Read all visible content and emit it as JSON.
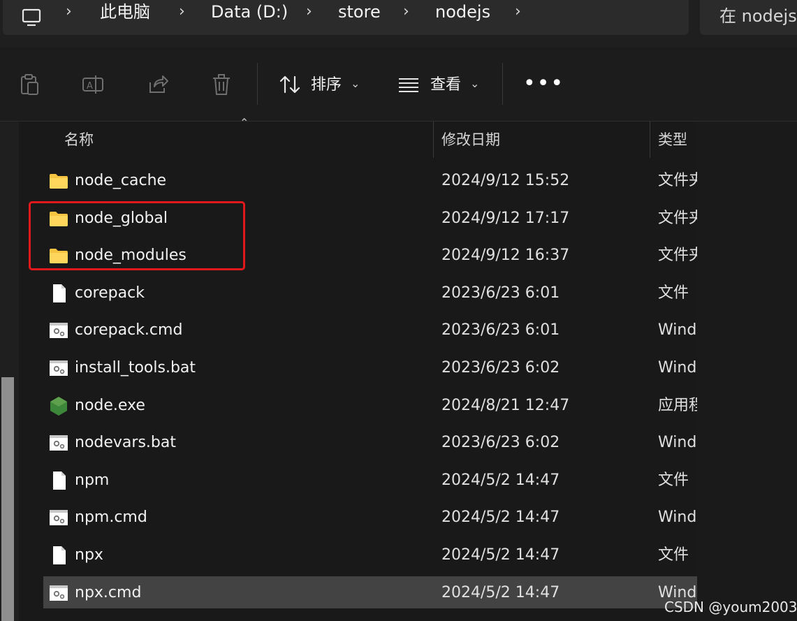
{
  "address_bar": {
    "breadcrumbs": [
      "此电脑",
      "Data (D:)",
      "store",
      "nodejs"
    ],
    "search_placeholder": "在 nodejs"
  },
  "toolbar": {
    "icons": [
      "paste-icon",
      "rename-icon",
      "share-icon",
      "delete-icon"
    ],
    "sort_label": "排序",
    "view_label": "查看",
    "more_label": "•••"
  },
  "columns": {
    "name": "名称",
    "modified": "修改日期",
    "type": "类型"
  },
  "files": [
    {
      "name": "node_cache",
      "modified": "2024/9/12 15:52",
      "type": "文件夹",
      "icon": "folder-icon"
    },
    {
      "name": "node_global",
      "modified": "2024/9/12 17:17",
      "type": "文件夹",
      "icon": "folder-icon"
    },
    {
      "name": "node_modules",
      "modified": "2024/9/12 16:37",
      "type": "文件夹",
      "icon": "folder-icon"
    },
    {
      "name": "corepack",
      "modified": "2023/6/23 6:01",
      "type": "文件",
      "icon": "file-icon"
    },
    {
      "name": "corepack.cmd",
      "modified": "2023/6/23 6:01",
      "type": "Windows",
      "icon": "script-icon"
    },
    {
      "name": "install_tools.bat",
      "modified": "2023/6/23 6:02",
      "type": "Windows",
      "icon": "script-icon"
    },
    {
      "name": "node.exe",
      "modified": "2024/8/21 12:47",
      "type": "应用程序",
      "icon": "nodejs-icon"
    },
    {
      "name": "nodevars.bat",
      "modified": "2023/6/23 6:02",
      "type": "Windows",
      "icon": "script-icon"
    },
    {
      "name": "npm",
      "modified": "2024/5/2 14:47",
      "type": "文件",
      "icon": "file-icon"
    },
    {
      "name": "npm.cmd",
      "modified": "2024/5/2 14:47",
      "type": "Windows",
      "icon": "script-icon"
    },
    {
      "name": "npx",
      "modified": "2024/5/2 14:47",
      "type": "文件",
      "icon": "file-icon"
    },
    {
      "name": "npx.cmd",
      "modified": "2024/5/2 14:47",
      "type": "Windows",
      "icon": "script-icon",
      "selected": true
    }
  ],
  "watermark": "CSDN @youm2003",
  "colors": {
    "highlight": "#e0181b",
    "folder": "#f5c542",
    "node_green": "#3c873a"
  }
}
